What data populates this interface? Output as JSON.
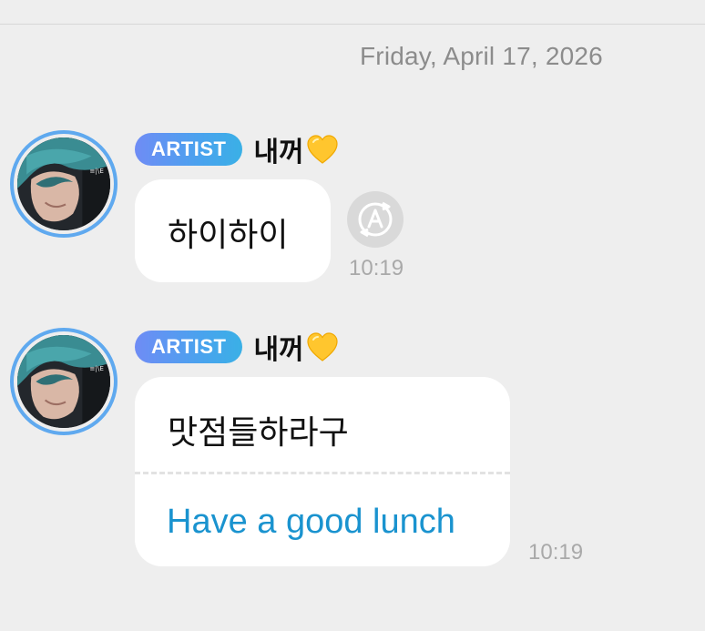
{
  "date_header": "Friday, April 17, 2026",
  "messages": [
    {
      "badge": "ARTIST",
      "sender": "내꺼",
      "heart_icon": "yellow-heart-icon",
      "text": "하이하이",
      "time": "10:19",
      "has_translate_button": true
    },
    {
      "badge": "ARTIST",
      "sender": "내꺼",
      "heart_icon": "yellow-heart-icon",
      "text": "맛점들하라구",
      "translation": "Have a good lunch",
      "time": "10:19"
    }
  ],
  "colors": {
    "background": "#eeeeee",
    "badge_gradient_start": "#6f8cf5",
    "badge_gradient_end": "#3ab0e6",
    "avatar_ring": "#5fa9ef",
    "translation_text": "#1a93cf",
    "timestamp": "#a9a9a9",
    "heart": "#ffc62e"
  }
}
